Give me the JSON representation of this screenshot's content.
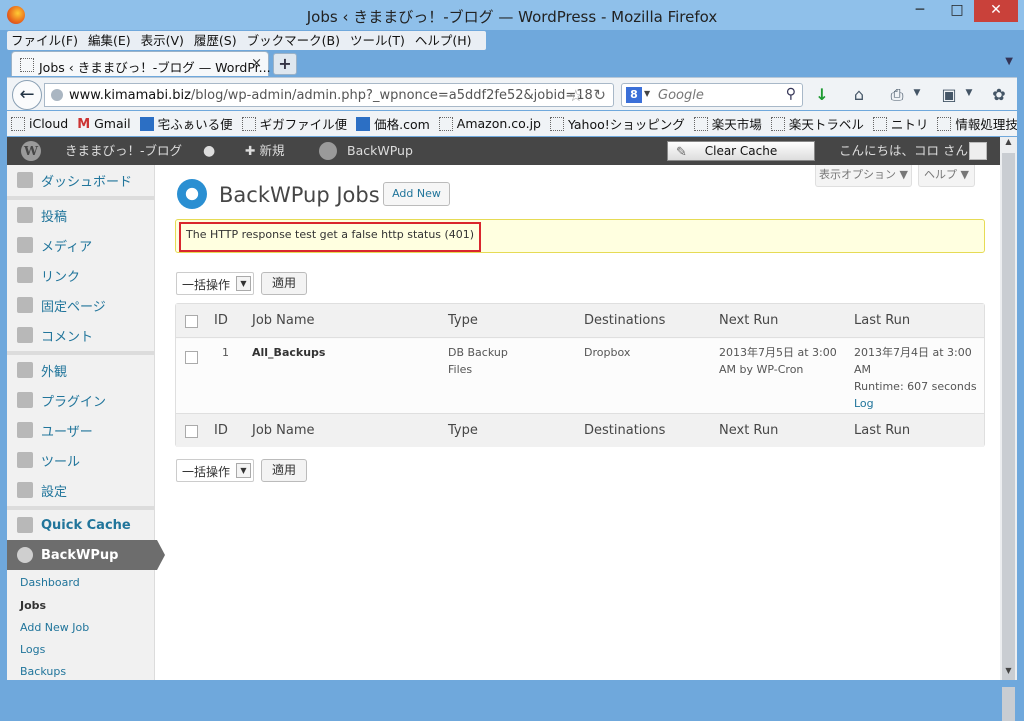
{
  "window": {
    "title": "Jobs ‹ きままびっ！-ブログ — WordPress - Mozilla Firefox",
    "min": "─",
    "max": "□",
    "close": "✕"
  },
  "menu": [
    "ファイル(F)",
    "編集(E)",
    "表示(V)",
    "履歴(S)",
    "ブックマーク(B)",
    "ツール(T)",
    "ヘルプ(H)"
  ],
  "tab": {
    "title": "Jobs ‹ きままびっ！-ブログ — WordPr...",
    "close": "×",
    "new": "+"
  },
  "nav": {
    "url_host": "www.kimamabi.biz",
    "url_path": "/blog/wp-admin/admin.php?_wpnonce=a5ddf2fe52&jobid=18",
    "search_placeholder": "Google",
    "search_engine": "8"
  },
  "bookmarks": [
    "iCloud",
    "Gmail",
    "宅ふぁいる便",
    "ギガファイル便",
    "価格.com",
    "Amazon.co.jp",
    "Yahoo!ショッピング",
    "楽天市場",
    "楽天トラベル",
    "ニトリ",
    "情報処理技術者試験..."
  ],
  "adminbar": {
    "site": "きままびっ！-ブログ",
    "new": "✚ 新規",
    "plugin": "BackWPup",
    "clear_cache": "Clear Cache",
    "howdy": "こんにちは、コロ さん！"
  },
  "sidebar": {
    "items": [
      "ダッシュボード",
      "投稿",
      "メディア",
      "リンク",
      "固定ページ",
      "コメント",
      "外観",
      "プラグイン",
      "ユーザー",
      "ツール",
      "設定",
      "Quick Cache",
      "BackWPup"
    ],
    "sub": [
      "Dashboard",
      "Jobs",
      "Add New Job",
      "Logs",
      "Backups"
    ]
  },
  "screen_options": "表示オプション ▼",
  "help": "ヘルプ ▼",
  "page_title": "BackWPup Jobs",
  "add_new": "Add New",
  "notice": "The HTTP response test get a false http status (401)",
  "bulk_label": "一括操作",
  "apply_label": "適用",
  "columns": [
    "ID",
    "Job Name",
    "Type",
    "Destinations",
    "Next Run",
    "Last Run"
  ],
  "job": {
    "id": "1",
    "name": "All_Backups",
    "type": [
      "DB Backup",
      "Files"
    ],
    "destination": "Dropbox",
    "next_run": "2013年7月5日 at 3:00 AM by WP-Cron",
    "last_run": "2013年7月4日 at 3:00 AM",
    "runtime": "Runtime: 607 seconds",
    "log": "Log"
  }
}
